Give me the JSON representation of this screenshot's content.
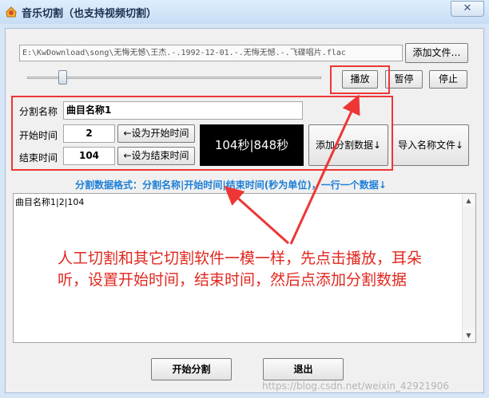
{
  "window": {
    "title": "音乐切割（也支持视频切割）",
    "close_symbol": "✕"
  },
  "file": {
    "path": "E:\\KwDownload\\song\\无悔无憾\\王杰.-.1992-12-01.-.无悔无憾.-.飞碟唱片.flac",
    "add_button": "添加文件…"
  },
  "playback": {
    "play": "播放",
    "pause": "暂停",
    "stop": "停止",
    "position_fraction": 0.12
  },
  "segment": {
    "name_label": "分割名称",
    "name_value": "曲目名称1",
    "start_label": "开始时间",
    "start_value": "2",
    "set_start_button": "←设为开始时间",
    "end_label": "结束时间",
    "end_value": "104",
    "set_end_button": "←设为结束时间",
    "display": "104秒|848秒",
    "add_data_button": "添加分割数据↓",
    "import_names_button": "导入名称文件↓"
  },
  "format_hint": "分割数据格式：分割名称|开始时间|结束时间(秒为单位)，一行一个数据↓",
  "data_text": "曲目名称1|2|104",
  "annotation": "人工切割和其它切割软件一模一样，先点击播放，耳朵听，设置开始时间，结束时间，然后点添加分割数据",
  "actions": {
    "start": "开始分割",
    "exit": "退出"
  },
  "watermark": "https://blog.csdn.net/weixin_42921906",
  "colors": {
    "annotation_red": "#ee3636",
    "hint_blue": "#1c7fd6"
  }
}
